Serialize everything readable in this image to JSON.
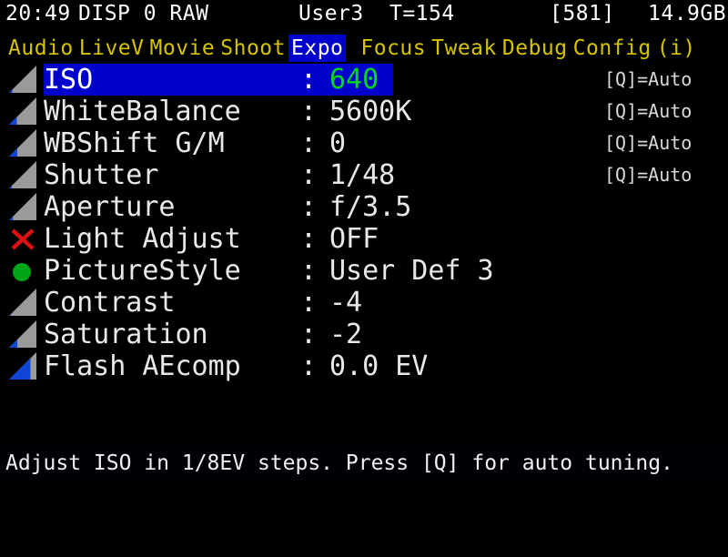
{
  "statusbar": {
    "clock": "20:49",
    "display_mode": "DISP 0 RAW",
    "user_mode": "User3",
    "temperature": "T=154",
    "shots_remaining": "[581]",
    "card_space": "14.9GB"
  },
  "tabbar": {
    "items": [
      {
        "label": "Audio",
        "selected": false
      },
      {
        "label": "LiveV",
        "selected": false
      },
      {
        "label": "Movie",
        "selected": false
      },
      {
        "label": "Shoot",
        "selected": false
      },
      {
        "label": "Expo",
        "selected": true
      },
      {
        "label": "Focus",
        "selected": false
      },
      {
        "label": "Tweak",
        "selected": false
      },
      {
        "label": "Debug",
        "selected": false
      },
      {
        "label": "Config",
        "selected": false
      },
      {
        "label": "(i)",
        "selected": false
      }
    ]
  },
  "menu": {
    "rows": [
      {
        "icon": "slider-ramp-icon",
        "fill": 0.12,
        "label": "ISO",
        "colon": ":",
        "value": "640",
        "hint": "[Q]=Auto",
        "selected": true
      },
      {
        "icon": "slider-ramp-icon",
        "fill": 0.28,
        "label": "WhiteBalance",
        "colon": ":",
        "value": "5600K",
        "hint": "[Q]=Auto",
        "selected": false
      },
      {
        "icon": "slider-ramp-icon",
        "fill": 0.3,
        "label": "WBShift G/M",
        "colon": ":",
        "value": "0",
        "hint": "[Q]=Auto",
        "selected": false
      },
      {
        "icon": "slider-ramp-icon",
        "fill": 0.1,
        "label": "Shutter",
        "colon": ":",
        "value": "1/48",
        "hint": "[Q]=Auto",
        "selected": false
      },
      {
        "icon": "slider-ramp-icon",
        "fill": 0.14,
        "label": "Aperture",
        "colon": ":",
        "value": "f/3.5",
        "hint": "",
        "selected": false
      },
      {
        "icon": "red-x-icon",
        "fill": 0,
        "label": "Light Adjust",
        "colon": ":",
        "value": "OFF",
        "hint": "",
        "selected": false
      },
      {
        "icon": "green-dot-icon",
        "fill": 0,
        "label": "PictureStyle",
        "colon": ":",
        "value": "User Def 3",
        "hint": "",
        "selected": false
      },
      {
        "icon": "slider-ramp-icon",
        "fill": 0.06,
        "label": "Contrast",
        "colon": ":",
        "value": "-4",
        "hint": "",
        "selected": false
      },
      {
        "icon": "slider-ramp-icon",
        "fill": 0.3,
        "label": "Saturation",
        "colon": ":",
        "value": "-2",
        "hint": "",
        "selected": false
      },
      {
        "icon": "slider-ramp-icon",
        "fill": 0.78,
        "label": "Flash AEcomp",
        "colon": ":",
        "value": "0.0 EV",
        "hint": "",
        "selected": false
      }
    ]
  },
  "footer": {
    "help": "Adjust ISO in 1/8EV steps. Press [Q] for auto tuning."
  },
  "colors": {
    "background": "#000000",
    "tab_text": "#d4c400",
    "highlight": "#0000cc",
    "value_selected": "#00d820",
    "text": "#e8e8e8",
    "icon_gray": "#9a9a9a",
    "icon_blue": "#1046d8",
    "icon_red": "#dd1111",
    "icon_green": "#00a417"
  }
}
